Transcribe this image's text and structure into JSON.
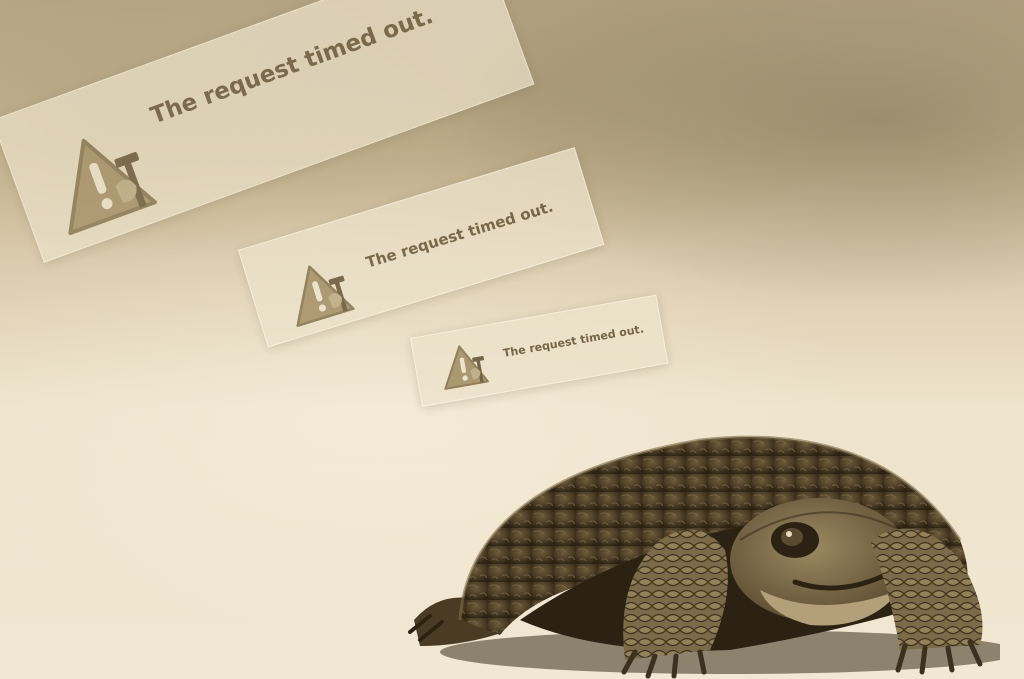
{
  "dialogs": [
    {
      "message": "The request timed out.",
      "icon": "warning-triangle-icon"
    },
    {
      "message": "The request timed out.",
      "icon": "warning-triangle-icon"
    },
    {
      "message": "The request timed out.",
      "icon": "warning-triangle-icon"
    }
  ],
  "subject": {
    "name": "turtle"
  },
  "colors": {
    "sepia_light": "#f1e7d2",
    "sepia_mid": "#c9b894",
    "sepia_dark": "#3a2f1e",
    "text": "#6f5e3f"
  }
}
